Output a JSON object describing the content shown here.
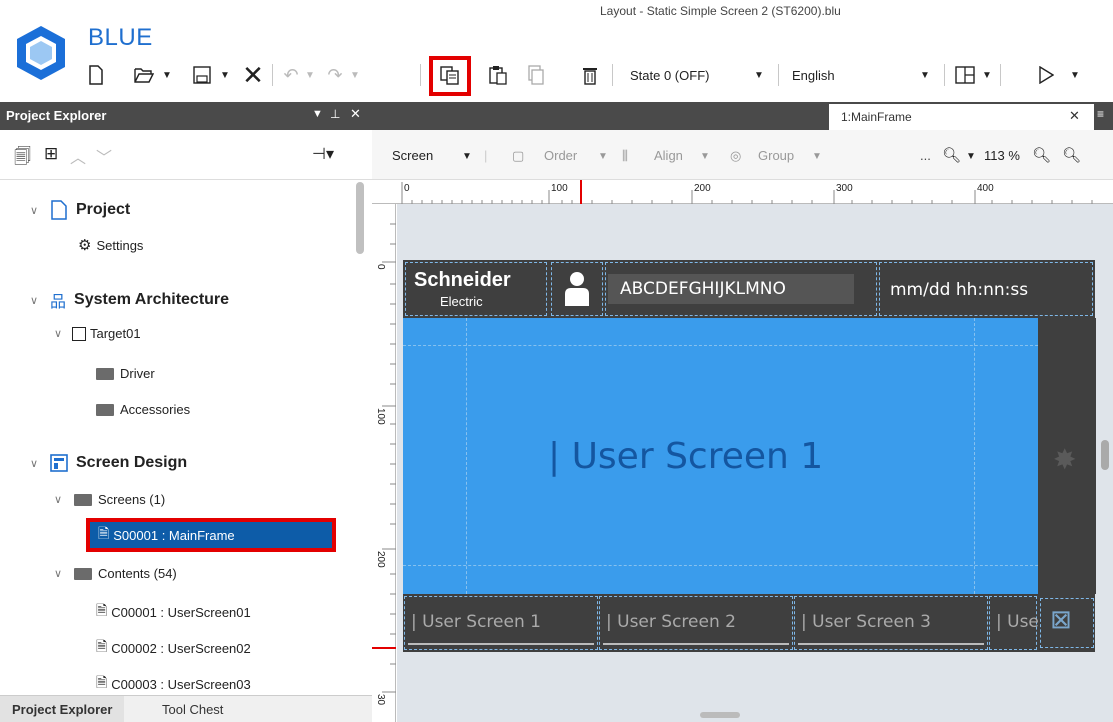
{
  "app": {
    "brand": "BLUE",
    "title": "Layout - Static Simple Screen 2 (ST6200).blu"
  },
  "toolbar": {
    "state": "State 0 (OFF)",
    "language": "English",
    "icons": [
      "new-file-icon",
      "open-icon",
      "save-icon",
      "close-x-icon",
      "undo-icon",
      "redo-icon",
      "copy-icon",
      "paste-icon",
      "duplicate-icon",
      "delete-icon",
      "layout-icon",
      "run-icon"
    ]
  },
  "project_explorer": {
    "title": "Project Explorer",
    "tree": {
      "project": "Project",
      "settings": "Settings",
      "system_architecture": "System Architecture",
      "target": "Target01",
      "driver": "Driver",
      "accessories": "Accessories",
      "screen_design": "Screen Design",
      "screens": "Screens (1)",
      "selected_screen": "S00001 : MainFrame",
      "contents": "Contents (54)",
      "content_items": [
        "C00001 : UserScreen01",
        "C00002 : UserScreen02",
        "C00003 : UserScreen03"
      ]
    },
    "bottom_tabs": [
      "Project Explorer",
      "Tool Chest"
    ]
  },
  "editor": {
    "tab": "1:MainFrame",
    "screen_dropdown": "Screen",
    "order": "Order",
    "align": "Align",
    "group": "Group",
    "more": "...",
    "zoom": "113 %",
    "ruler_top": [
      "0",
      "100",
      "200",
      "300",
      "400"
    ],
    "ruler_left": [
      "0",
      "100",
      "200",
      "30"
    ]
  },
  "hmi": {
    "logo_line1": "Schneider",
    "logo_line2": "Electric",
    "user_text": "ABCDEFGHIJKLMNO",
    "datetime": "mm/dd hh:nn:ss",
    "main_label": "| User Screen 1",
    "nav": [
      "| User Screen 1",
      "| User Screen 2",
      "| User Screen 3",
      "| Use"
    ]
  },
  "colors": {
    "accent": "#1f6fcf",
    "selection": "#0d5ca8",
    "highlight": "#e30000",
    "hmi_blue": "#3a9cec",
    "hmi_dark": "#3f3f3f"
  }
}
